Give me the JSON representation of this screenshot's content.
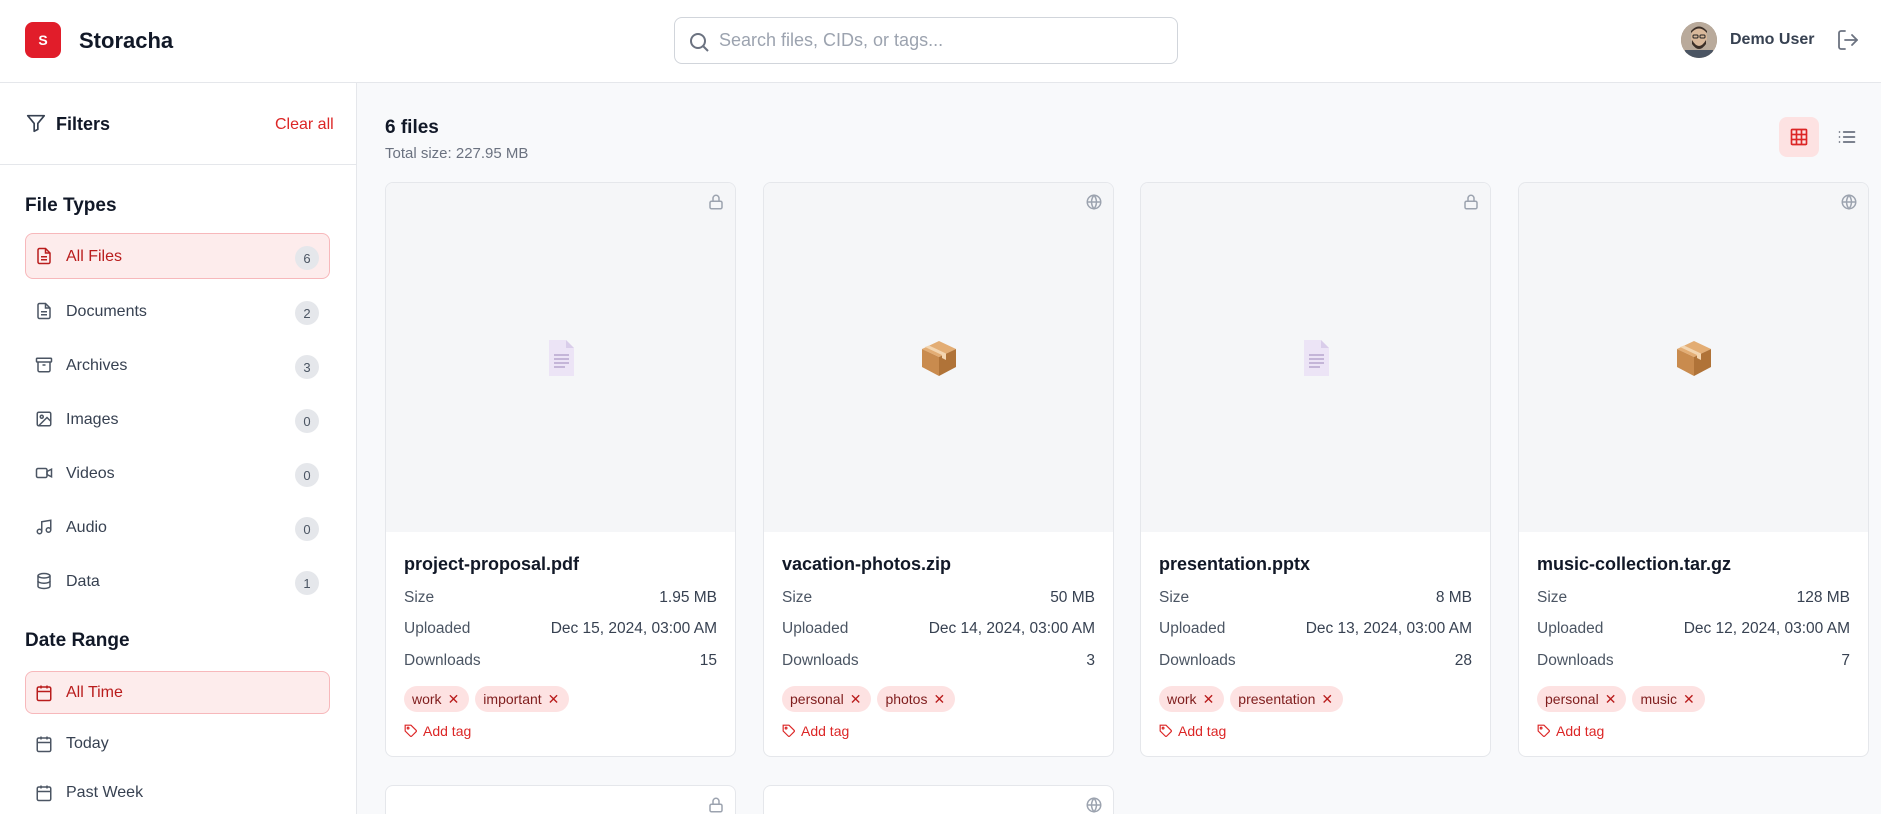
{
  "header": {
    "logo_letter": "S",
    "app_title": "Storacha",
    "search_placeholder": "Search files, CIDs, or tags...",
    "user_name": "Demo User"
  },
  "sidebar": {
    "filters_title": "Filters",
    "clear_all": "Clear all",
    "file_types_title": "File Types",
    "file_types": [
      {
        "label": "All Files",
        "count": "6",
        "icon": "file-icon",
        "active": true
      },
      {
        "label": "Documents",
        "count": "2",
        "icon": "document-icon"
      },
      {
        "label": "Archives",
        "count": "3",
        "icon": "archive-icon"
      },
      {
        "label": "Images",
        "count": "0",
        "icon": "image-icon"
      },
      {
        "label": "Videos",
        "count": "0",
        "icon": "video-icon"
      },
      {
        "label": "Audio",
        "count": "0",
        "icon": "music-icon"
      },
      {
        "label": "Data",
        "count": "1",
        "icon": "database-icon"
      }
    ],
    "date_range_title": "Date Range",
    "date_ranges": [
      {
        "label": "All Time",
        "icon": "calendar-icon",
        "active": true
      },
      {
        "label": "Today",
        "icon": "calendar-icon"
      },
      {
        "label": "Past Week",
        "icon": "calendar-icon"
      }
    ]
  },
  "main": {
    "files_count": "6 files",
    "total_size": "Total size: 227.95 MB",
    "labels": {
      "size": "Size",
      "uploaded": "Uploaded",
      "downloads": "Downloads",
      "add_tag": "Add tag"
    },
    "files": [
      {
        "name": "project-proposal.pdf",
        "size": "1.95 MB",
        "uploaded": "Dec 15, 2024, 03:00 AM",
        "downloads": "15",
        "tags": [
          "work",
          "important"
        ],
        "visibility": "lock-icon",
        "thumb": "document-thumb-icon"
      },
      {
        "name": "vacation-photos.zip",
        "size": "50 MB",
        "uploaded": "Dec 14, 2024, 03:00 AM",
        "downloads": "3",
        "tags": [
          "personal",
          "photos"
        ],
        "visibility": "globe-icon",
        "thumb": "package-thumb-icon"
      },
      {
        "name": "presentation.pptx",
        "size": "8 MB",
        "uploaded": "Dec 13, 2024, 03:00 AM",
        "downloads": "28",
        "tags": [
          "work",
          "presentation"
        ],
        "visibility": "lock-icon",
        "thumb": "document-thumb-icon"
      },
      {
        "name": "music-collection.tar.gz",
        "size": "128 MB",
        "uploaded": "Dec 12, 2024, 03:00 AM",
        "downloads": "7",
        "tags": [
          "personal",
          "music"
        ],
        "visibility": "globe-icon",
        "thumb": "package-thumb-icon"
      }
    ],
    "partial_cards": [
      {
        "visibility": "lock-icon"
      },
      {
        "visibility": "globe-icon"
      }
    ]
  },
  "colors": {
    "accent": "#dc2626",
    "accent_bg": "#fde2e2",
    "brand": "#e11d2a"
  }
}
